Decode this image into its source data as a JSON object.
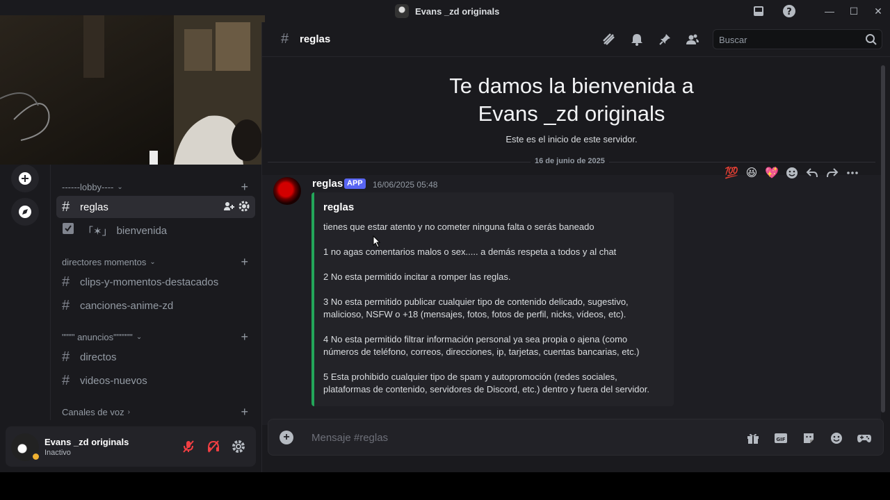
{
  "window": {
    "title": "Evans _zd originals"
  },
  "header": {
    "channel_name": "reglas",
    "search_placeholder": "Buscar"
  },
  "server": {
    "categories": [
      {
        "label": "------lobby----",
        "channels": [
          {
            "name": "reglas",
            "type": "text",
            "active": true
          },
          {
            "name": "bienvenida",
            "prefix": "「✶」",
            "type": "rules"
          }
        ]
      },
      {
        "label": "directores momentos",
        "channels": [
          {
            "name": "clips-y-momentos-destacados"
          },
          {
            "name": "canciones-anime-zd"
          }
        ]
      },
      {
        "label": "\"\"\"\" anuncios\"\"\"\"\"\"",
        "channels": [
          {
            "name": "directos"
          },
          {
            "name": "videos-nuevos"
          }
        ]
      },
      {
        "label": "Canales de voz",
        "channels": []
      }
    ]
  },
  "user": {
    "name": "Evans _zd originals",
    "status": "Inactivo"
  },
  "welcome": {
    "line1": "Te damos la bienvenida a",
    "line2": "Evans _zd originals",
    "subtitle": "Este es el inicio de este servidor."
  },
  "date_divider": "16 de junio de 2025",
  "message": {
    "author": "reglas",
    "badge": "APP",
    "timestamp": "16/06/2025 05:48",
    "embed": {
      "title": "reglas",
      "lines": [
        "tienes que estar atento y no cometer ninguna falta o serás baneado",
        "1 no agas comentarios malos o sex..... a demás respeta a todos y al chat",
        "2 No esta permitido incitar a romper las reglas.",
        "3 No esta permitido publicar cualquier tipo de contenido delicado, sugestivo,",
        "malicioso, NSFW o +18 (mensajes, fotos, fotos de perfil, nicks, vídeos, etc).",
        "4 No esta permitido filtrar información personal ya sea propia o ajena (como",
        "números de teléfono, correos, direcciones, ip, tarjetas, cuentas bancarias, etc.)",
        "5 Esta prohibido cualquier tipo de spam y autopromoción (redes sociales,",
        "plataformas de contenido, servidores de Discord, etc.) dentro y fuera del servidor."
      ]
    }
  },
  "reactions": [
    "💯",
    "😆",
    "💖"
  ],
  "composer": {
    "placeholder": "Mensaje #reglas"
  },
  "colors": {
    "accent": "#5865f2",
    "embed_border": "#23a559",
    "mute_red": "#f23f43",
    "idle": "#f0b232"
  }
}
